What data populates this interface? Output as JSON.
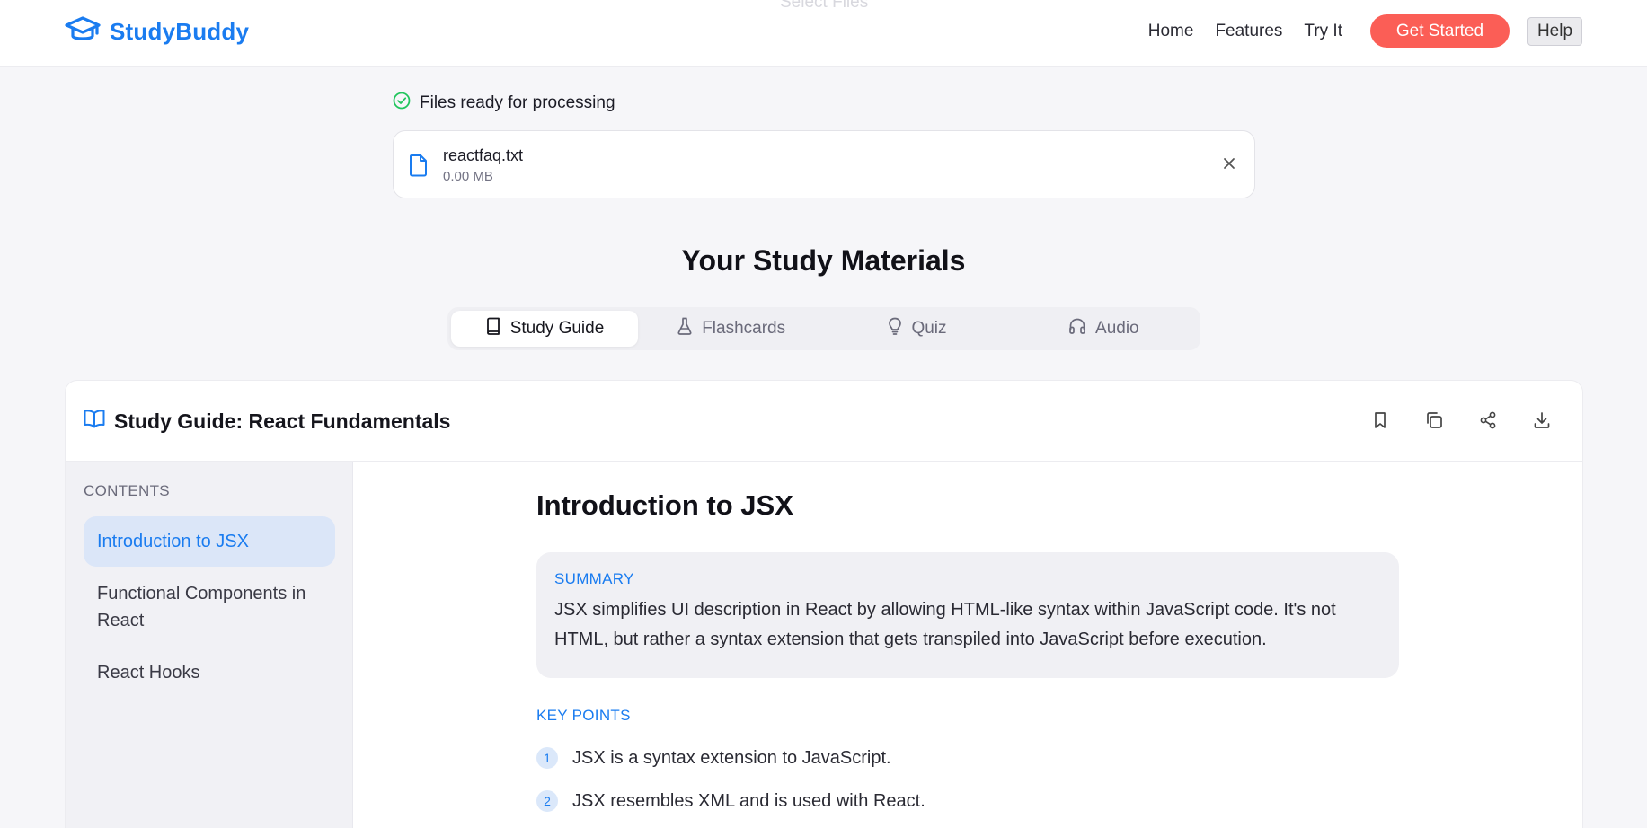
{
  "ghost_text": "Select Files",
  "header": {
    "brand": "StudyBuddy",
    "nav": [
      "Home",
      "Features",
      "Try It"
    ],
    "cta": "Get Started",
    "help": "Help"
  },
  "upload": {
    "status": "Files ready for processing",
    "file": {
      "name": "reactfaq.txt",
      "size": "0.00 MB"
    }
  },
  "materials": {
    "title": "Your Study Materials",
    "tabs": [
      {
        "label": "Study Guide",
        "icon": "book-icon",
        "active": true
      },
      {
        "label": "Flashcards",
        "icon": "flask-icon",
        "active": false
      },
      {
        "label": "Quiz",
        "icon": "lightbulb-icon",
        "active": false
      },
      {
        "label": "Audio",
        "icon": "headphones-icon",
        "active": false
      }
    ]
  },
  "guide": {
    "title": "Study Guide: React Fundamentals",
    "actions": [
      "bookmark-icon",
      "copy-icon",
      "share-icon",
      "download-icon"
    ],
    "contents_label": "CONTENTS",
    "toc": [
      "Introduction to JSX",
      "Functional Components in React",
      "React Hooks"
    ],
    "section": {
      "heading": "Introduction to JSX",
      "summary_label": "SUMMARY",
      "summary": "JSX simplifies UI description in React by allowing HTML-like syntax within JavaScript code. It's not HTML, but rather a syntax extension that gets transpiled into JavaScript before execution.",
      "key_points_label": "KEY POINTS",
      "key_points": [
        {
          "num": "1",
          "text": "JSX is a syntax extension to JavaScript."
        },
        {
          "num": "2",
          "text": "JSX resembles XML and is used with React."
        }
      ]
    }
  },
  "colors": {
    "brand": "#1a7cf0",
    "cta": "#fb5e56",
    "success": "#22c55e"
  }
}
